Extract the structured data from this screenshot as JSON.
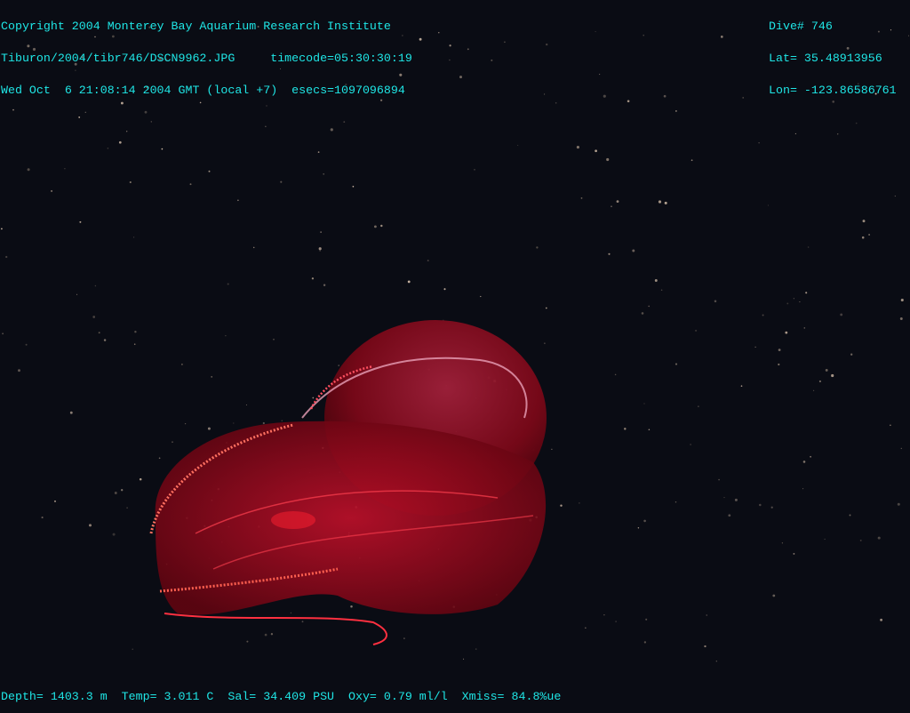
{
  "header_left": {
    "copyright": "Copyright 2004 Monterey Bay Aquarium Research Institute",
    "file_line": "Tiburon/2004/tibr746/DSCN9962.JPG     timecode=05:30:30:19",
    "date_line": "Wed Oct  6 21:08:14 2004 GMT (local +7)  esecs=1097096894"
  },
  "header_right": {
    "dive": "Dive# 746",
    "lat": "Lat= 35.48913956",
    "lon": "Lon= -123.86586761"
  },
  "footer": {
    "sensors": "Depth= 1403.3 m  Temp= 3.011 C  Sal= 34.409 PSU  Oxy= 0.79 ml/l  Xmiss= 84.8%ue"
  },
  "colors": {
    "overlay_text": "#1fe6e6",
    "background": "#0a0c14",
    "jelly": "#c0102a"
  }
}
